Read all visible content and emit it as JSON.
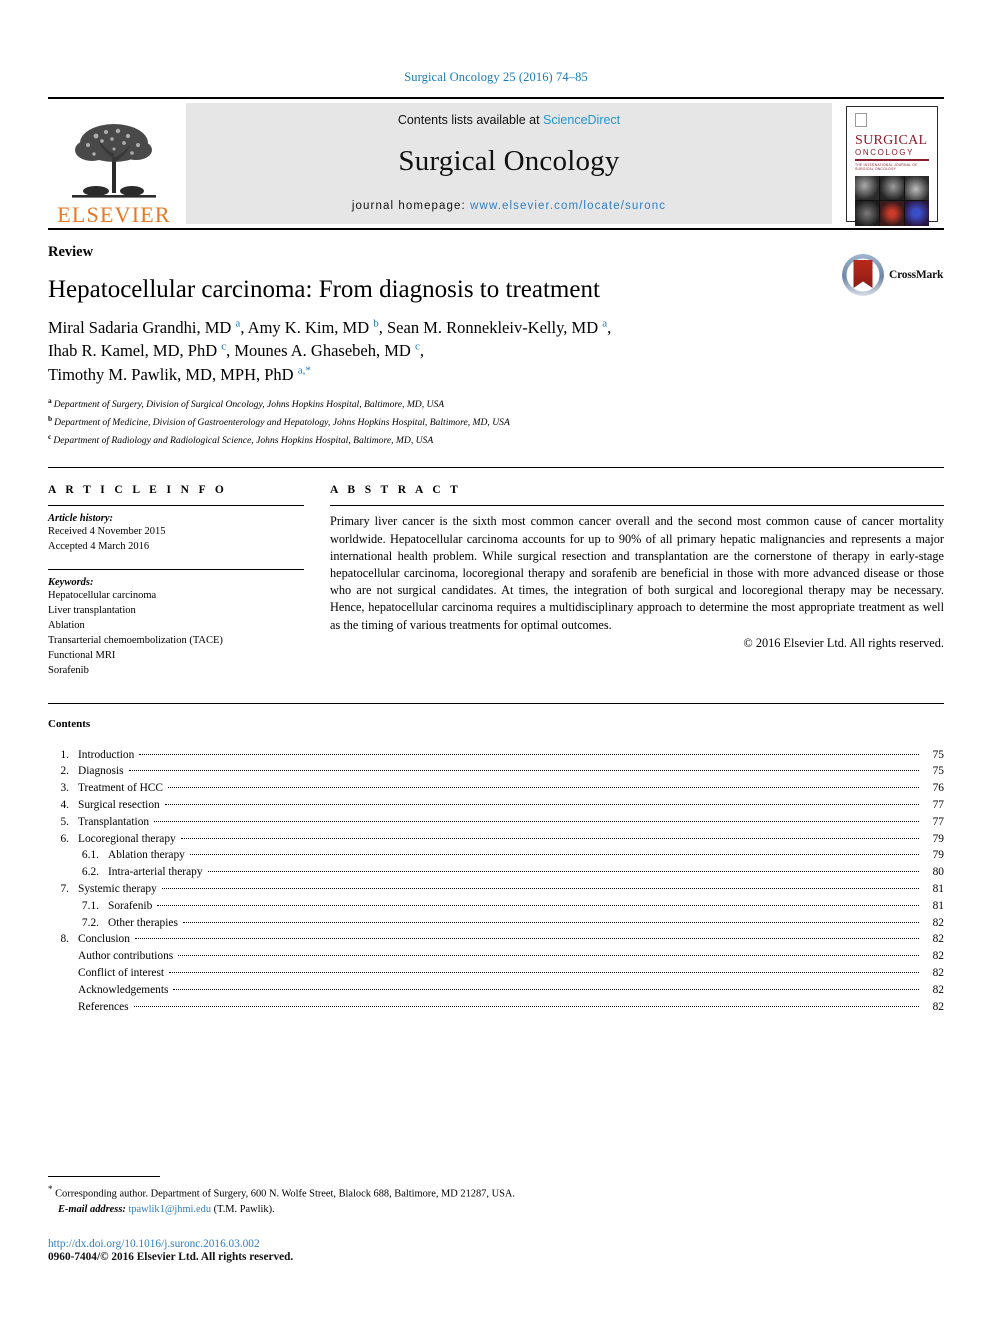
{
  "running_head": "Surgical Oncology 25 (2016) 74–85",
  "masthead": {
    "publisher_name": "ELSEVIER",
    "contents_prefix": "Contents lists available at ",
    "sciencedirect_link": "ScienceDirect",
    "journal_title": "Surgical Oncology",
    "homepage_prefix": "journal homepage: ",
    "homepage_link": "www.elsevier.com/locate/suronc",
    "cover": {
      "title_top": "SURGICAL",
      "title_bottom": "ONCOLOGY",
      "subtitle": "THE INTERNATIONAL JOURNAL OF SURGICAL ONCOLOGY"
    }
  },
  "article": {
    "type_label": "Review",
    "title": "Hepatocellular carcinoma: From diagnosis to treatment",
    "crossmark_label": "CrossMark",
    "authors_line1_a": "Miral Sadaria Grandhi, MD ",
    "authors_line1_b": ", Amy K. Kim, MD ",
    "authors_line1_c": ", Sean M. Ronnekleiv-Kelly, MD ",
    "authors_line2_a": "Ihab R. Kamel, MD, PhD ",
    "authors_line2_b": ", Mounes A. Ghasebeh, MD ",
    "authors_line3_a": "Timothy M. Pawlik, MD, MPH, PhD ",
    "sup_a": "a",
    "sup_b": "b",
    "sup_c": "c",
    "sup_star": "*",
    "affiliations": [
      {
        "mark": "a",
        "text": "Department of Surgery, Division of Surgical Oncology, Johns Hopkins Hospital, Baltimore, MD, USA"
      },
      {
        "mark": "b",
        "text": "Department of Medicine, Division of Gastroenterology and Hepatology, Johns Hopkins Hospital, Baltimore, MD, USA"
      },
      {
        "mark": "c",
        "text": "Department of Radiology and Radiological Science, Johns Hopkins Hospital, Baltimore, MD, USA"
      }
    ]
  },
  "article_info": {
    "heading": "A R T I C L E   I N F O",
    "history_label": "Article history:",
    "history_lines": [
      "Received 4 November 2015",
      "Accepted 4 March 2016"
    ],
    "keywords_label": "Keywords:",
    "keywords": [
      "Hepatocellular carcinoma",
      "Liver transplantation",
      "Ablation",
      "Transarterial chemoembolization (TACE)",
      "Functional MRI",
      "Sorafenib"
    ]
  },
  "abstract": {
    "heading": "A B S T R A C T",
    "body": "Primary liver cancer is the sixth most common cancer overall and the second most common cause of cancer mortality worldwide. Hepatocellular carcinoma accounts for up to 90% of all primary hepatic malignancies and represents a major international health problem. While surgical resection and transplantation are the cornerstone of therapy in early-stage hepatocellular carcinoma, locoregional therapy and sorafenib are beneficial in those with more advanced disease or those who are not surgical candidates. At times, the integration of both surgical and locoregional therapy may be necessary. Hence, hepatocellular carcinoma requires a multidisciplinary approach to determine the most appropriate treatment as well as the timing of various treatments for optimal outcomes.",
    "copyright": "© 2016 Elsevier Ltd. All rights reserved."
  },
  "contents": {
    "heading": "Contents",
    "entries": [
      {
        "num": "1.",
        "label": "Introduction",
        "page": "75",
        "level": 1
      },
      {
        "num": "2.",
        "label": "Diagnosis",
        "page": "75",
        "level": 1
      },
      {
        "num": "3.",
        "label": "Treatment of HCC",
        "page": "76",
        "level": 1
      },
      {
        "num": "4.",
        "label": "Surgical resection",
        "page": "77",
        "level": 1
      },
      {
        "num": "5.",
        "label": "Transplantation",
        "page": "77",
        "level": 1
      },
      {
        "num": "6.",
        "label": "Locoregional therapy",
        "page": "79",
        "level": 1
      },
      {
        "num": "6.1.",
        "label": "Ablation therapy",
        "page": "79",
        "level": 2
      },
      {
        "num": "6.2.",
        "label": "Intra-arterial therapy",
        "page": "80",
        "level": 2
      },
      {
        "num": "7.",
        "label": "Systemic therapy",
        "page": "81",
        "level": 1
      },
      {
        "num": "7.1.",
        "label": "Sorafenib",
        "page": "81",
        "level": 2
      },
      {
        "num": "7.2.",
        "label": "Other therapies",
        "page": "82",
        "level": 2
      },
      {
        "num": "8.",
        "label": "Conclusion",
        "page": "82",
        "level": 1
      },
      {
        "num": "",
        "label": "Author contributions",
        "page": "82",
        "level": 3
      },
      {
        "num": "",
        "label": "Conflict of interest",
        "page": "82",
        "level": 3
      },
      {
        "num": "",
        "label": "Acknowledgements",
        "page": "82",
        "level": 3
      },
      {
        "num": "",
        "label": "References",
        "page": "82",
        "level": 3
      }
    ]
  },
  "footer": {
    "corresponding_star": "*",
    "corresponding_text": "Corresponding author. Department of Surgery, 600 N. Wolfe Street, Blalock 688, Baltimore, MD 21287, USA.",
    "email_label": "E-mail address:",
    "email": "tpawlik1@jhmi.edu",
    "email_suffix": "(T.M. Pawlik).",
    "doi": "http://dx.doi.org/10.1016/j.suronc.2016.03.002",
    "issn_line": "0960-7404/© 2016 Elsevier Ltd. All rights reserved."
  },
  "colors": {
    "link_blue": "#2f7ec1",
    "header_blue": "#1a7bb9",
    "sciencedirect_blue": "#2196cd",
    "elsevier_orange": "#E87722",
    "cover_red": "#8c1d2c",
    "masthead_gray": "#e6e6e6"
  }
}
